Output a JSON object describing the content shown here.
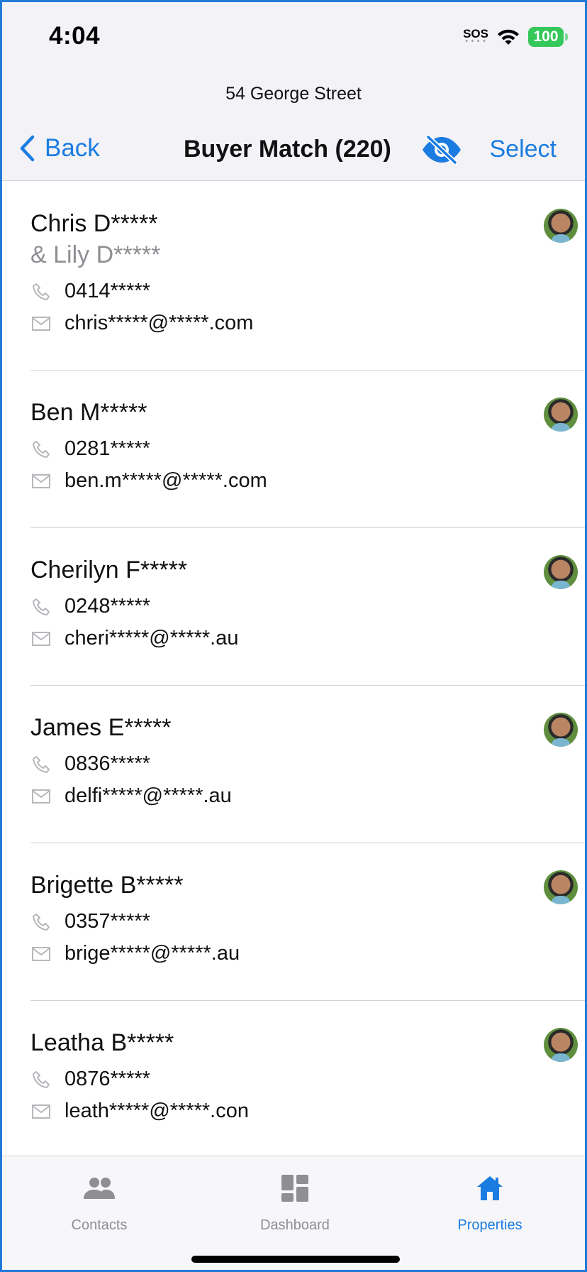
{
  "status": {
    "time": "4:04",
    "sos": "SOS",
    "battery": "100"
  },
  "header": {
    "address": "54 George Street",
    "back_label": "Back",
    "title": "Buyer Match (220)",
    "select_label": "Select"
  },
  "contacts": [
    {
      "name": "Chris D*****",
      "partner": "& Lily D*****",
      "phone": "0414*****",
      "email": "chris*****@*****.com"
    },
    {
      "name": "Ben M*****",
      "phone": "0281*****",
      "email": "ben.m*****@*****.com"
    },
    {
      "name": "Cherilyn F*****",
      "phone": "0248*****",
      "email": "cheri*****@*****.au"
    },
    {
      "name": "James E*****",
      "phone": "0836*****",
      "email": "delfi*****@*****.au"
    },
    {
      "name": "Brigette B*****",
      "phone": "0357*****",
      "email": "brige*****@*****.au"
    },
    {
      "name": "Leatha B*****",
      "phone": "0876*****",
      "email": "leath*****@*****.con"
    }
  ],
  "tabs": [
    {
      "label": "Contacts",
      "icon": "people-icon"
    },
    {
      "label": "Dashboard",
      "icon": "dashboard-icon"
    },
    {
      "label": "Properties",
      "icon": "home-icon",
      "active": true
    }
  ],
  "colors": {
    "accent": "#1a7ce0",
    "secondary_text": "#8e8e93",
    "battery": "#34c759"
  }
}
